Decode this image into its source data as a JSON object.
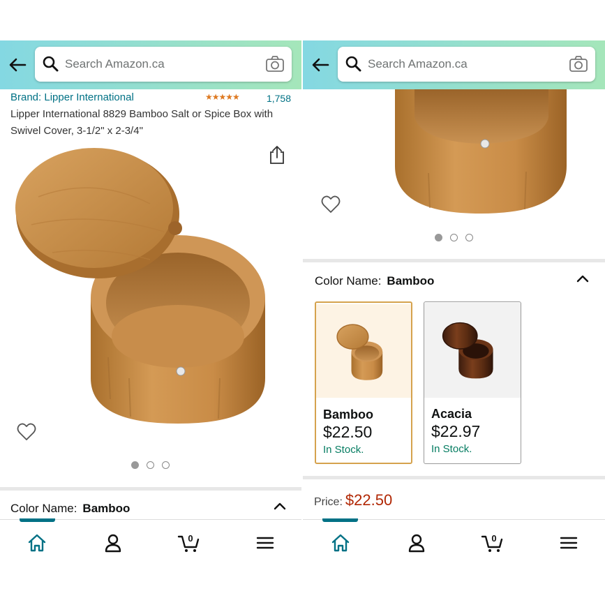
{
  "search": {
    "placeholder": "Search Amazon.ca"
  },
  "product": {
    "brand": "Brand: Lipper International",
    "rating_stars": "★★★★★",
    "rating_value": 4.5,
    "review_count": "1,758",
    "title": "Lipper International 8829 Bamboo Salt or Spice Box with Swivel Cover, 3-1/2\" x 2-3/4\""
  },
  "variation": {
    "label": "Color Name:",
    "selected": "Bamboo",
    "options": [
      {
        "name": "Bamboo",
        "price": "$22.50",
        "stock": "In Stock."
      },
      {
        "name": "Acacia",
        "price": "$22.97",
        "stock": "In Stock."
      }
    ]
  },
  "price": {
    "label": "Price:",
    "value": "$22.50"
  },
  "carousel": {
    "count": 3,
    "active": 1
  },
  "icons": {
    "back": "arrow-left-icon",
    "search": "search-icon",
    "camera": "camera-icon",
    "share": "share-icon",
    "wishlist": "heart-icon",
    "collapse": "chevron-up-icon",
    "nav": [
      "home-icon",
      "account-icon",
      "cart-icon",
      "menu-icon"
    ]
  },
  "cart": {
    "count": "0"
  },
  "colors": {
    "link": "#007185",
    "star": "#de7921",
    "price": "#b12704",
    "in_stock": "#067d62",
    "selected_border": "#d5a24d",
    "header_start": "#84d8e2",
    "header_end": "#a5e6ba"
  }
}
